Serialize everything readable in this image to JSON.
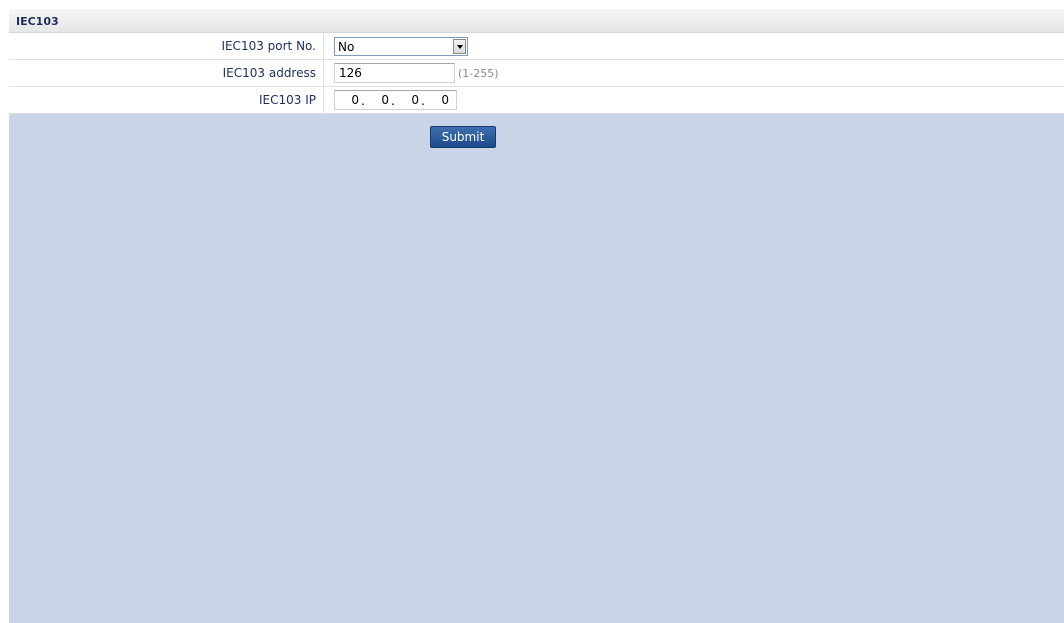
{
  "section": {
    "title": "IEC103"
  },
  "form": {
    "port": {
      "label": "IEC103 port No.",
      "selected": "No"
    },
    "address": {
      "label": "IEC103 address",
      "value": "126",
      "hint": "(1-255)"
    },
    "ip": {
      "label": "IEC103 IP",
      "octets": [
        "0",
        "0",
        "0",
        "0"
      ],
      "separator": "."
    }
  },
  "actions": {
    "submit_label": "Submit"
  },
  "colors": {
    "background": "#c9d4e9",
    "label_text": "#1d2f5c",
    "button": "#1d4a8a"
  }
}
